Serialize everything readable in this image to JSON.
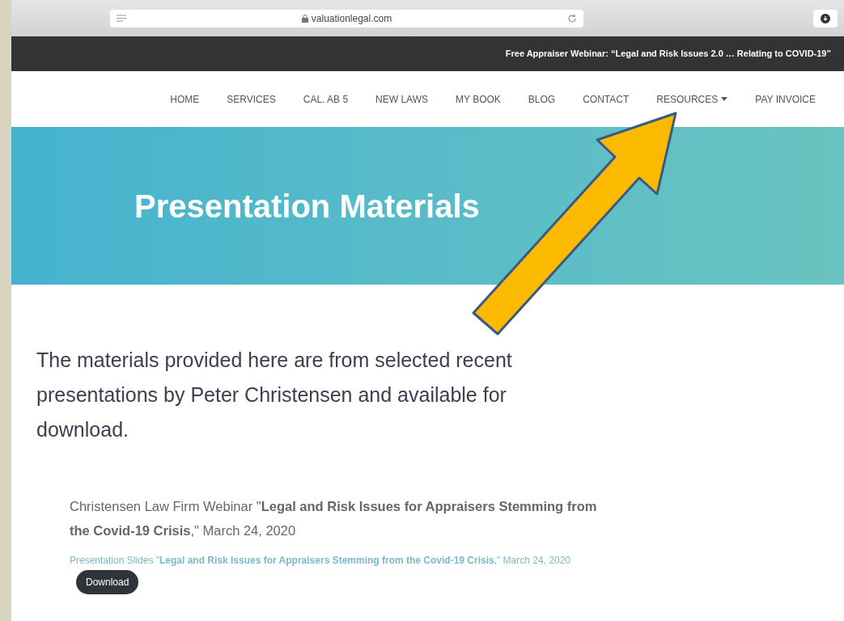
{
  "browser": {
    "address": "valuationlegal.com"
  },
  "announcement": "Free Appraiser Webinar: “Legal and Risk Issues 2.0 … Relating to COVID-19”",
  "nav": [
    {
      "label": "HOME",
      "dropdown": false
    },
    {
      "label": "SERVICES",
      "dropdown": false
    },
    {
      "label": "CAL. AB 5",
      "dropdown": false
    },
    {
      "label": "NEW LAWS",
      "dropdown": false
    },
    {
      "label": "MY BOOK",
      "dropdown": false
    },
    {
      "label": "BLOG",
      "dropdown": false
    },
    {
      "label": "CONTACT",
      "dropdown": false
    },
    {
      "label": "RESOURCES",
      "dropdown": true
    },
    {
      "label": "PAY INVOICE",
      "dropdown": false
    }
  ],
  "hero": {
    "title": "Presentation Materials"
  },
  "intro": "The materials provided here are from selected recent presentations by Peter Christensen and available for download.",
  "entry": {
    "title": "Christensen Law Firm Webinar \"**Legal and Risk Issues for Appraisers Stemming from the Covid-19 Crisis**,\" March 24, 2020",
    "slides": "Presentation Slides \"**Legal and Risk Issues for Appraisers Stemming from the Covid-19 Crisis**,\" March 24, 2020",
    "button": "Download"
  }
}
